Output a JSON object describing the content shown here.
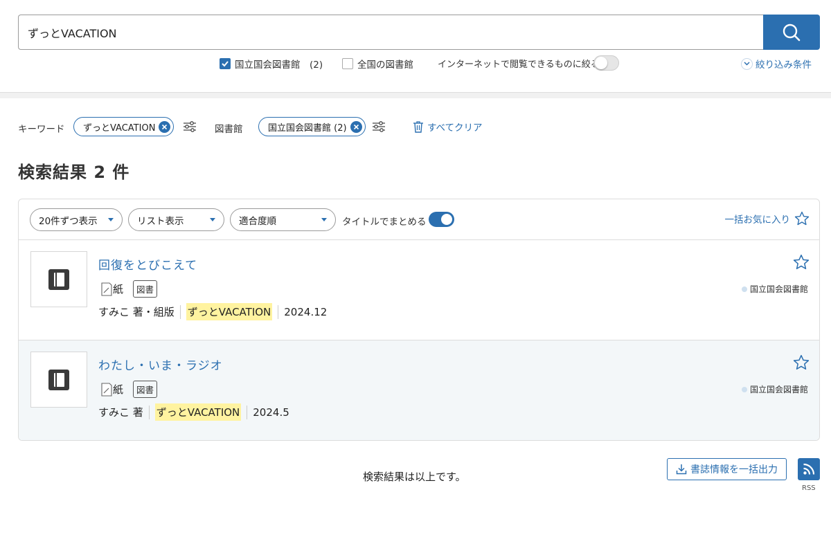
{
  "search": {
    "query": "ずっとVACATION"
  },
  "scope": {
    "ndl_label": "国立国会図書館　(2)",
    "national_label": "全国の図書館",
    "internet_label": "インターネットで閲覧できるものに絞る",
    "narrow_label": "絞り込み条件"
  },
  "applied": {
    "keyword_label": "キーワード",
    "keyword_chip": "ずっとVACATION",
    "library_label": "図書館",
    "library_chip": "国立国会図書館 (2)",
    "clear_label": "すべてクリア"
  },
  "results_title": "検索結果 2 件",
  "toolbar": {
    "per_page": "20件ずつ表示",
    "view": "リスト表示",
    "sort": "適合度順",
    "group_label": "タイトルでまとめる",
    "bulk_fav": "一括お気に入り"
  },
  "results": [
    {
      "title": "回復をとびこえて",
      "media": "紙",
      "type_tag": "図書",
      "author": "すみこ 著・組版",
      "series": "ずっとVACATION",
      "date": "2024.12",
      "library": "国立国会図書館"
    },
    {
      "title": "わたし・いま・ラジオ",
      "media": "紙",
      "type_tag": "図書",
      "author": "すみこ 著",
      "series": "ずっとVACATION",
      "date": "2024.5",
      "library": "国立国会図書館"
    }
  ],
  "footer": {
    "end_text": "検索結果は以上です。",
    "export_label": "書誌情報を一括出力",
    "rss_label": "RSS"
  },
  "colors": {
    "accent": "#2b6fb0",
    "highlight": "#fff3a0"
  }
}
